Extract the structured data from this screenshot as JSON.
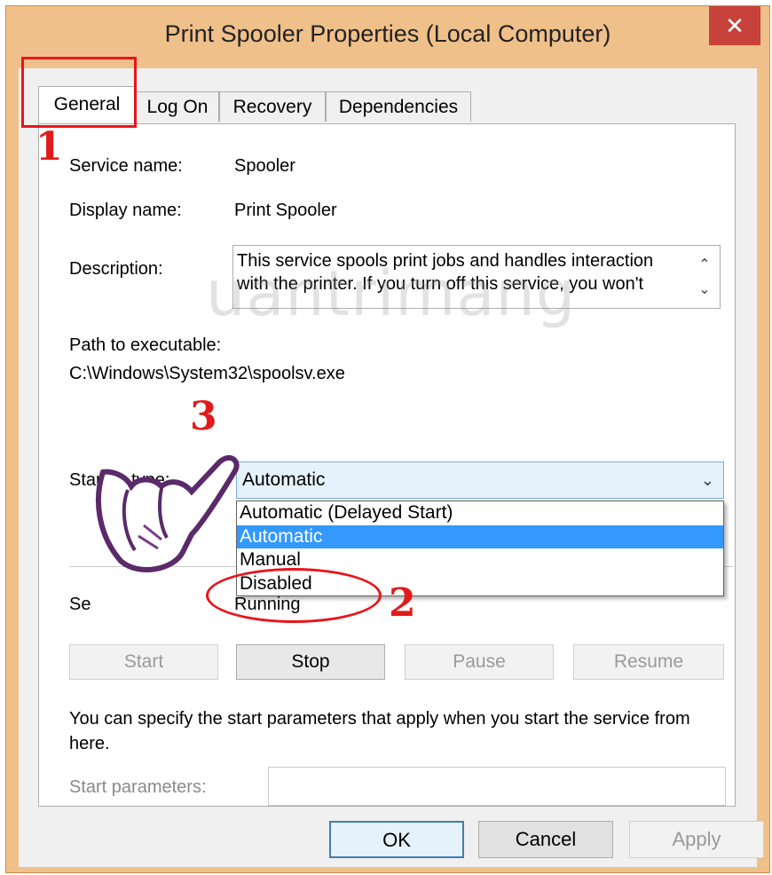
{
  "window": {
    "title": "Print Spooler Properties (Local Computer)",
    "close_glyph": "✕"
  },
  "tabs": [
    {
      "label": "General",
      "active": true
    },
    {
      "label": "Log On",
      "active": false
    },
    {
      "label": "Recovery",
      "active": false
    },
    {
      "label": "Dependencies",
      "active": false
    }
  ],
  "general": {
    "service_name_label": "Service name:",
    "service_name_value": "Spooler",
    "display_name_label": "Display name:",
    "display_name_value": "Print Spooler",
    "description_label": "Description:",
    "description_value": "This service spools print jobs and handles interaction with the printer.  If you turn off this service, you won't",
    "path_label": "Path to executable:",
    "path_value": "C:\\Windows\\System32\\spoolsv.exe",
    "startup_type_label": "Startup type:",
    "startup_type_value": "Automatic",
    "startup_options": [
      "Automatic (Delayed Start)",
      "Automatic",
      "Manual",
      "Disabled"
    ],
    "startup_selected": "Automatic",
    "service_status_label": "Se",
    "service_status_value": "Running",
    "buttons": {
      "start": "Start",
      "stop": "Stop",
      "pause": "Pause",
      "resume": "Resume"
    },
    "hint": "You can specify the start parameters that apply when you start the service from here.",
    "start_params_label": "Start parameters:",
    "start_params_value": ""
  },
  "footer": {
    "ok": "OK",
    "cancel": "Cancel",
    "apply": "Apply"
  },
  "annotations": {
    "step1": "1",
    "step2": "2",
    "step3": "3",
    "color": "#e8151b"
  },
  "watermark": "uantrimang",
  "icons": {
    "scroll_up": "chevron-up-icon",
    "scroll_down": "chevron-down-icon",
    "combo": "chevron-down-icon",
    "hand": "pointing-hand-icon"
  }
}
